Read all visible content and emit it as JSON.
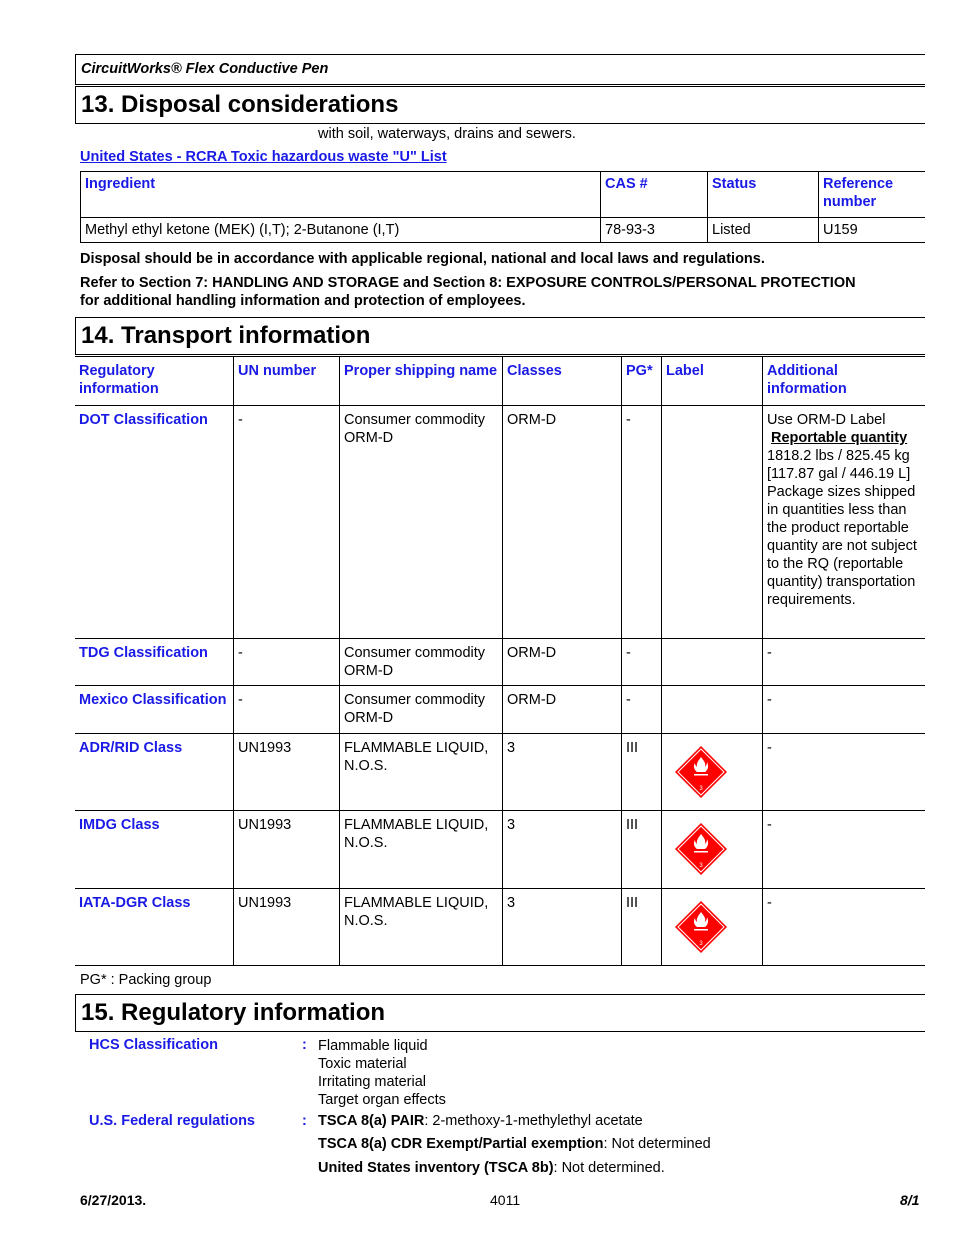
{
  "header": {
    "product": "CircuitWorks® Flex Conductive Pen"
  },
  "section13": {
    "title": "13. Disposal considerations",
    "continued_text": "with soil, waterways, drains and sewers.",
    "rcra_link": "United States - RCRA Toxic hazardous waste \"U\" List",
    "table": {
      "headers": [
        "Ingredient",
        "CAS #",
        "Status",
        "Reference number"
      ],
      "rows": [
        [
          "Methyl ethyl ketone (MEK) (I,T); 2-Butanone (I,T)",
          "78-93-3",
          "Listed",
          "U159"
        ]
      ]
    },
    "note1": "Disposal should be in accordance with applicable regional, national and local laws and regulations.",
    "note2_line1": "Refer to Section 7: HANDLING AND STORAGE and Section 8: EXPOSURE CONTROLS/PERSONAL PROTECTION",
    "note2_line2": "for additional handling information and protection of employees."
  },
  "section14": {
    "title": "14. Transport information",
    "headers": [
      "Regulatory information",
      "UN number",
      "Proper shipping name",
      "Classes",
      "PG*",
      "Label",
      "Additional information"
    ],
    "rows": [
      {
        "reg": "DOT Classification",
        "un": "-",
        "name": "Consumer commodity ORM-D",
        "cls": "ORM-D",
        "pg": "-",
        "label": "",
        "info1": "Use ORM-D Label",
        "info_rq": "Reportable quantity",
        "info2": "1818.2 lbs / 825.45 kg [117.87 gal / 446.19 L] Package sizes shipped in quantities less than the product reportable quantity are not subject to the RQ (reportable quantity) transportation requirements."
      },
      {
        "reg": "TDG Classification",
        "un": "-",
        "name": "Consumer commodity ORM-D",
        "cls": "ORM-D",
        "pg": "-",
        "label": "",
        "info": "-"
      },
      {
        "reg": "Mexico Classification",
        "un": "-",
        "name": "Consumer commodity ORM-D",
        "cls": "ORM-D",
        "pg": "-",
        "label": "",
        "info": "-"
      },
      {
        "reg": "ADR/RID Class",
        "un": "UN1993",
        "name": "FLAMMABLE LIQUID, N.O.S.",
        "cls": "3",
        "pg": "III",
        "label": "flammable-liquid-class-3",
        "info": "-"
      },
      {
        "reg": "IMDG Class",
        "un": "UN1993",
        "name": "FLAMMABLE LIQUID, N.O.S.",
        "cls": "3",
        "pg": "III",
        "label": "flammable-liquid-class-3",
        "info": "-"
      },
      {
        "reg": "IATA-DGR Class",
        "un": "UN1993",
        "name": "FLAMMABLE LIQUID, N.O.S.",
        "cls": "3",
        "pg": "III",
        "label": "flammable-liquid-class-3",
        "info": "-"
      }
    ],
    "pg_note": "PG* : Packing group",
    "placard_number": "3",
    "placard_color": "#ff0000"
  },
  "section15": {
    "title": "15. Regulatory information",
    "hcs_label": "HCS Classification",
    "hcs_items": [
      "Flammable liquid",
      "Toxic material",
      "Irritating material",
      "Target organ effects"
    ],
    "federal_label": "U.S. Federal regulations",
    "federal_items": [
      {
        "key": "TSCA 8(a) PAIR",
        "value": ": 2-methoxy-1-methylethyl acetate"
      },
      {
        "key": "TSCA 8(a) CDR Exempt/Partial exemption",
        "value": ": Not determined"
      },
      {
        "key": "United States inventory (TSCA 8b)",
        "value": ": Not determined."
      }
    ],
    "colon": ":"
  },
  "footer": {
    "date": "6/27/2013.",
    "code": "4011",
    "page": "8/1"
  }
}
